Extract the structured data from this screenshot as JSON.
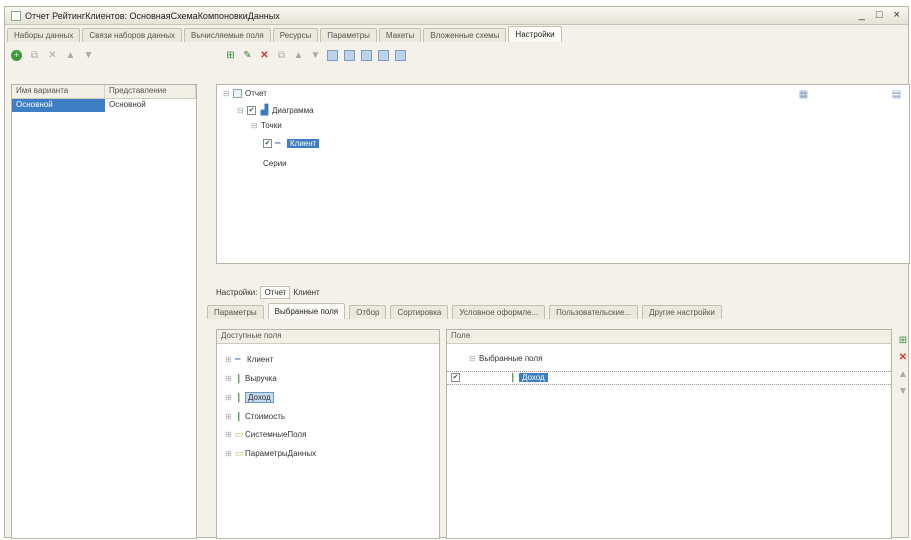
{
  "window": {
    "title": "Отчет РейтингКлиентов: ОсновнаяСхемаКомпоновкиДанных",
    "controls": "_ □ ×"
  },
  "tabs_top": [
    "Наборы данных",
    "Связи наборов данных",
    "Вычисляемые поля",
    "Ресурсы",
    "Параметры",
    "Макеты",
    "Вложенные схемы",
    "Настройки"
  ],
  "variants": {
    "headers": [
      "Имя варианта",
      "Представление"
    ],
    "rows": [
      {
        "name": "Основной",
        "view": "Основной"
      }
    ]
  },
  "structure": {
    "report": "Отчет",
    "chart": "Диаграмма",
    "points": "Точки",
    "client": "Клиент",
    "series": "Серии"
  },
  "settings": {
    "label": "Настройки:",
    "report_tab": "Отчет",
    "client_tab": "Клиент"
  },
  "tabs_mid": [
    "Параметры",
    "Выбранные поля",
    "Отбор",
    "Сортировка",
    "Условное оформле...",
    "Пользовательские...",
    "Другие настройки"
  ],
  "available_fields": {
    "header": "Доступные поля",
    "items": [
      "Клиент",
      "Выручка",
      "Доход",
      "Стоимость",
      "СистемныеПоля",
      "ПараметрыДанных"
    ]
  },
  "selected_fields": {
    "header": "Поле",
    "group": "Выбранные поля",
    "item": "Доход"
  }
}
